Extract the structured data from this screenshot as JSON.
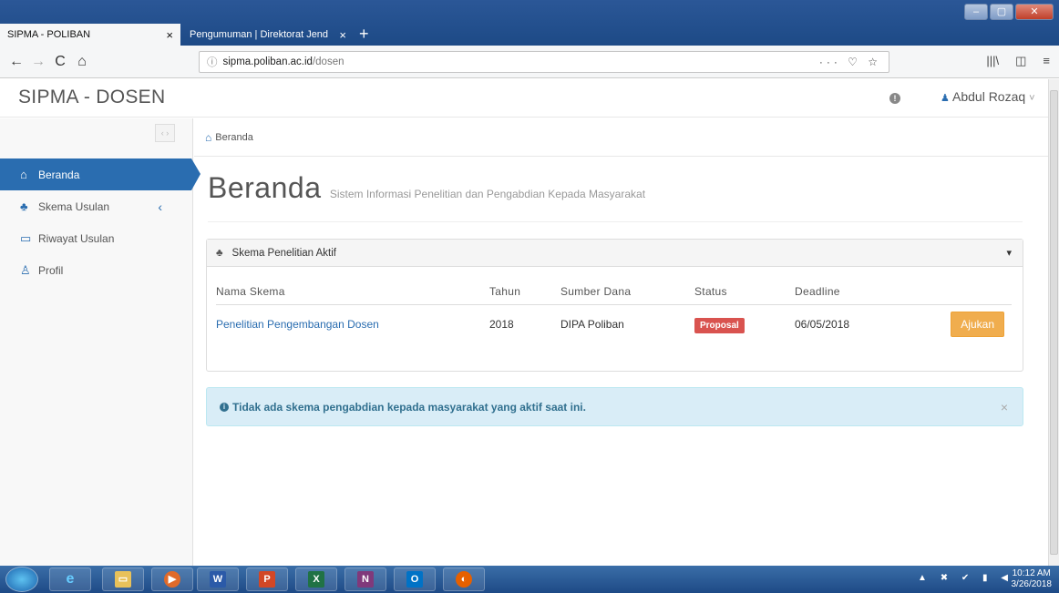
{
  "browser": {
    "tabs": [
      {
        "title": "SIPMA - POLIBAN",
        "close": "×"
      },
      {
        "title": "Pengumuman | Direktorat Jend",
        "close": "×"
      }
    ],
    "new_tab": "+",
    "url_domain": "sipma.poliban.ac.id",
    "url_path": "/dosen",
    "url_prefix_icon": "ⓘ",
    "url_actions": "··· ♡ ☆",
    "nav": {
      "back": "←",
      "forward": "→",
      "reload": "C",
      "home": "⌂"
    },
    "right_icons": [
      "|||\\",
      "◫",
      "≡"
    ]
  },
  "header": {
    "brand": "SIPMA - DOSEN",
    "user_name": "Abdul Rozaq",
    "user_caret": "˅"
  },
  "sidebar": {
    "toggle": "‹ ›",
    "items": [
      {
        "label": "Beranda",
        "icon": "home-icon",
        "active": true
      },
      {
        "label": "Skema Usulan",
        "icon": "sitemap-icon",
        "caret": "‹"
      },
      {
        "label": "Riwayat Usulan",
        "icon": "folder-icon"
      },
      {
        "label": "Profil",
        "icon": "user-icon"
      }
    ]
  },
  "breadcrumb": {
    "label": "Beranda"
  },
  "page": {
    "title": "Beranda",
    "subtitle": "Sistem Informasi Penelitian dan Pengabdian Kepada Masyarakat"
  },
  "panel": {
    "title": "Skema Penelitian Aktif",
    "columns": [
      "Nama Skema",
      "Tahun",
      "Sumber Dana",
      "Status",
      "Deadline"
    ],
    "rows": [
      {
        "nama": "Penelitian Pengembangan Dosen",
        "tahun": "2018",
        "sumber": "DIPA Poliban",
        "status": "Proposal",
        "deadline": "06/05/2018",
        "action": "Ajukan"
      }
    ]
  },
  "info_alert": {
    "text": "Tidak ada skema pengabdian kepada masyarakat yang aktif saat ini.",
    "close": "×"
  },
  "taskbar": {
    "apps": [
      "W",
      "P",
      "X",
      "N",
      "O"
    ],
    "clock_time": "10:12 AM",
    "clock_date": "3/26/2018"
  },
  "colors": {
    "primary": "#2a6db0",
    "status_danger": "#d9534f",
    "button_warning": "#f0ad4e",
    "info_bg": "#d9edf7"
  }
}
